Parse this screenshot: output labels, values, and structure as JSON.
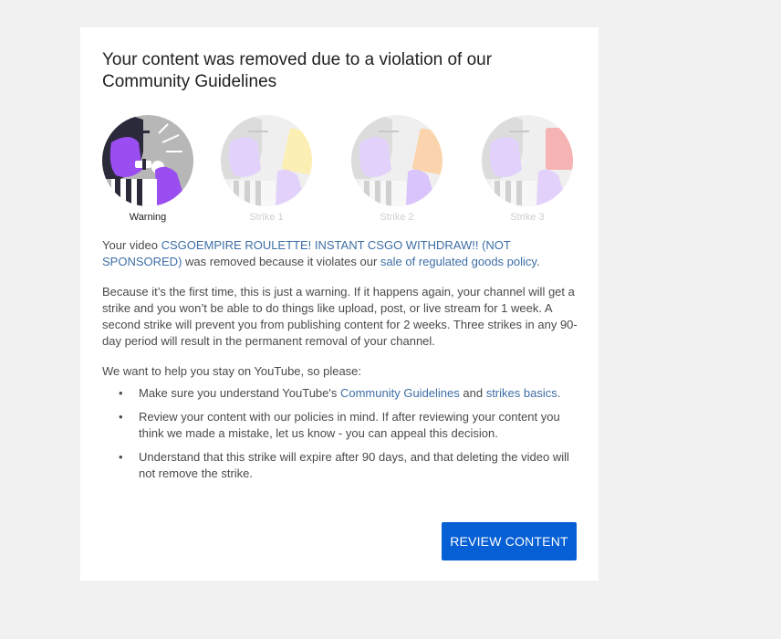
{
  "dialog": {
    "title": "Your content was removed due to a violation of our Community Guidelines",
    "stages": [
      {
        "label": "Warning"
      },
      {
        "label": "Strike 1"
      },
      {
        "label": "Strike 2"
      },
      {
        "label": "Strike 3"
      }
    ],
    "paragraph1": {
      "prefix": "Your video ",
      "video_title": "CSGOEMPIRE ROULETTE! INSTANT CSGO WITHDRAW!! (NOT SPONSORED)",
      "middle": " was removed because it violates our ",
      "policy_link": "sale of regulated goods policy",
      "suffix": "."
    },
    "paragraph2": "Because it’s the first time, this is just a warning. If it happens again, your channel will get a strike and you won’t be able to do things like upload, post, or live stream for 1 week. A second strike will prevent you from publishing content for 2 weeks. Three strikes in any 90-day period will result in the permanent removal of your channel.",
    "paragraph3": "We want to help you stay on YouTube, so please:",
    "bullet1": {
      "prefix": "Make sure you understand YouTube's ",
      "link1": "Community Guidelines",
      "middle": " and ",
      "link2": "strikes basics",
      "suffix": "."
    },
    "bullet2": "Review your content with our policies in mind. If after reviewing your content you think we made a mistake, let us know - you can appeal this decision.",
    "bullet3": "Understand that this strike will expire after 90 days, and that deleting the video will not remove the strike.",
    "bullet_glyph": "•",
    "review_button": "REVIEW CONTENT"
  },
  "colors": {
    "accent": "#065fd4",
    "link": "#3d6ea6",
    "background": "#f1f1f1"
  }
}
